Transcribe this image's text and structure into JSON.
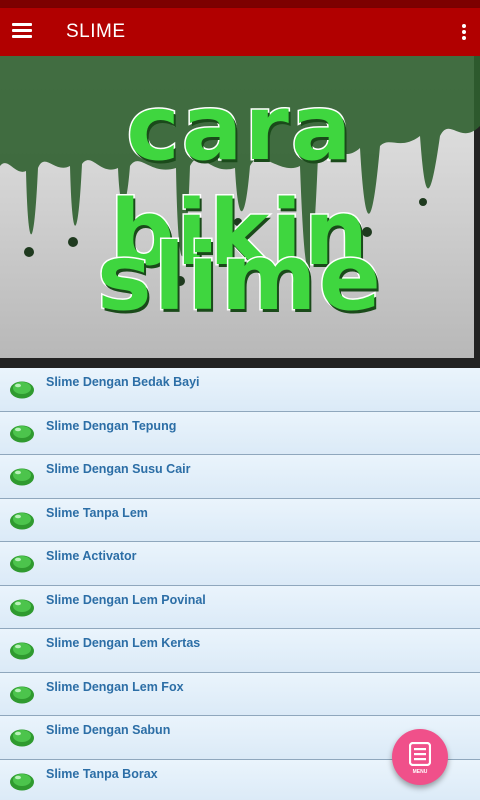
{
  "app_bar": {
    "title": "SLIME",
    "menu_icon": "hamburger-menu-icon",
    "overflow_icon": "more-vert-icon",
    "color": "#b10000"
  },
  "banner": {
    "line1": "cara bikin",
    "line2": "slime",
    "text_color": "#3fd63f",
    "drip_color": "#1f4a1f"
  },
  "list": {
    "item_icon": "green-slime-icon",
    "items": [
      {
        "label": "Slime Dengan Bedak Bayi"
      },
      {
        "label": "Slime Dengan Tepung"
      },
      {
        "label": "Slime Dengan Susu Cair"
      },
      {
        "label": "Slime Tanpa Lem"
      },
      {
        "label": "Slime Activator"
      },
      {
        "label": "Slime Dengan Lem Povinal"
      },
      {
        "label": "Slime Dengan Lem Kertas"
      },
      {
        "label": "Slime Dengan Lem Fox"
      },
      {
        "label": "Slime Dengan Sabun"
      },
      {
        "label": "Slime Tanpa Borax"
      }
    ]
  },
  "fab": {
    "label": "MENU",
    "icon": "list-menu-icon",
    "color": "#f0508a"
  }
}
